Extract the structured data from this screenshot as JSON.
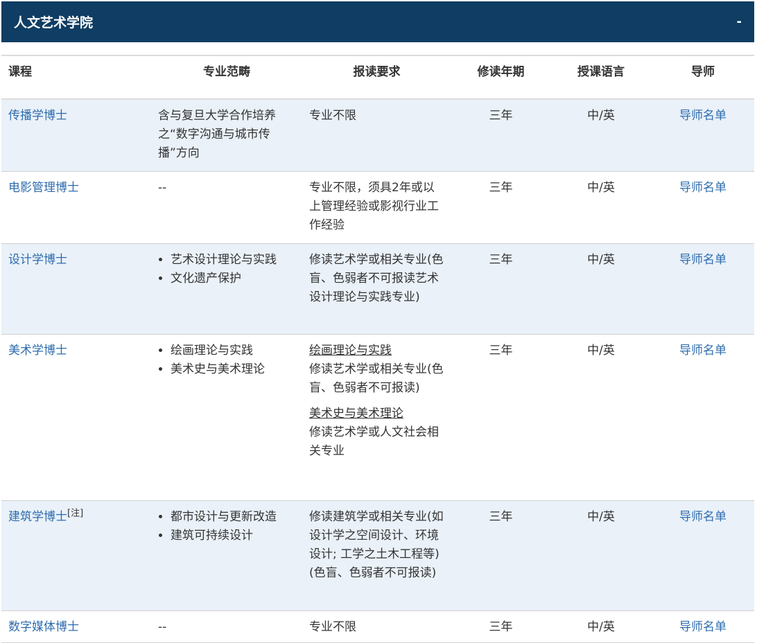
{
  "header": {
    "title": "人文艺术学院",
    "toggle_label": "-"
  },
  "columns": {
    "course": "课程",
    "field": "专业范畴",
    "requirement": "报读要求",
    "duration": "修读年期",
    "language": "授课语言",
    "tutor": "导师"
  },
  "rows": [
    {
      "course": "传播学博士",
      "field_text": "含与复旦大学合作培养之“数字沟通与城市传播”方向",
      "requirement": "专业不限",
      "duration": "三年",
      "language": "中/英",
      "tutor": "导师名单"
    },
    {
      "course": "电影管理博士",
      "field_text": "--",
      "requirement": "专业不限，须具2年或以上管理经验或影视行业工作经验",
      "duration": "三年",
      "language": "中/英",
      "tutor": "导师名单"
    },
    {
      "course": "设计学博士",
      "field_items": [
        "艺术设计理论与实践",
        "文化遗产保护"
      ],
      "requirement": "修读艺术学或相关专业(色盲、色弱者不可报读艺术设计理论与实践专业)",
      "duration": "三年",
      "language": "中/英",
      "tutor": "导师名单"
    },
    {
      "course": "美术学博士",
      "field_items": [
        "绘画理论与实践",
        "美术史与美术理论"
      ],
      "requirement_blocks": [
        {
          "heading": "绘画理论与实践",
          "text": "修读艺术学或相关专业(色盲、色弱者不可报读)"
        },
        {
          "heading": "美术史与美术理论",
          "text": "修读艺术学或人文社会相关专业"
        }
      ],
      "duration": "三年",
      "language": "中/英",
      "tutor": "导师名单"
    },
    {
      "course": "建筑学博士",
      "course_note": "[注]",
      "field_items": [
        "都市设计与更新改造",
        "建筑可持续设计"
      ],
      "requirement_lines": [
        "修读建筑学或相关专业(如设计学之空间设计、环境设计; 工学之土木工程等)",
        "(色盲、色弱者不可报读)"
      ],
      "duration": "三年",
      "language": "中/英",
      "tutor": "导师名单"
    },
    {
      "course": "数字媒体博士",
      "field_text": "--",
      "requirement": "专业不限",
      "duration": "三年",
      "language": "中/英",
      "tutor": "导师名单"
    }
  ],
  "colors": {
    "header_bg": "#0f3d63",
    "link": "#2d6cad",
    "alt_row": "#eaf1f9"
  }
}
